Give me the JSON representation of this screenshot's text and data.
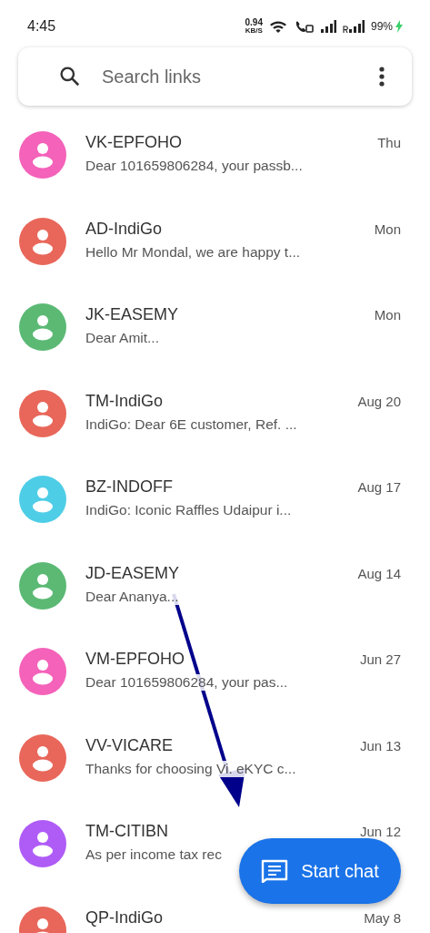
{
  "status_bar": {
    "time": "4:45",
    "speed": "0.94",
    "speed_unit": "KB/S",
    "battery": "99%",
    "charging": true
  },
  "search": {
    "placeholder": "Search links"
  },
  "conversations": [
    {
      "name": "VK-EPFOHO",
      "preview": "Dear 101659806284, your passb...",
      "date": "Thu",
      "color": "#f462b9"
    },
    {
      "name": "AD-IndiGo",
      "preview": "Hello Mr Mondal, we are happy t...",
      "date": "Mon",
      "color": "#e8675a"
    },
    {
      "name": "JK-EASEMY",
      "preview": "Dear Amit...",
      "date": "Mon",
      "color": "#5bb974"
    },
    {
      "name": "TM-IndiGo",
      "preview": "IndiGo: Dear 6E customer, Ref. ...",
      "date": "Aug 20",
      "color": "#e8675a"
    },
    {
      "name": "BZ-INDOFF",
      "preview": "IndiGo: Iconic Raffles Udaipur i...",
      "date": "Aug 17",
      "color": "#4ecde6"
    },
    {
      "name": "JD-EASEMY",
      "preview": "Dear Ananya...",
      "date": "Aug 14",
      "color": "#5bb974"
    },
    {
      "name": "VM-EPFOHO",
      "preview": "Dear 101659806284, your pas...",
      "date": "Jun 27",
      "color": "#f462b9"
    },
    {
      "name": "VV-VICARE",
      "preview": "Thanks for choosing Vi. eKYC c...",
      "date": "Jun 13",
      "color": "#e8675a"
    },
    {
      "name": "TM-CITIBN",
      "preview": "As per income tax rec",
      "date": "Jun 12",
      "color": "#af5cf7"
    },
    {
      "name": "QP-IndiGo",
      "date": "May 8",
      "color": "#e8675a"
    }
  ],
  "fab": {
    "label": "Start chat"
  }
}
